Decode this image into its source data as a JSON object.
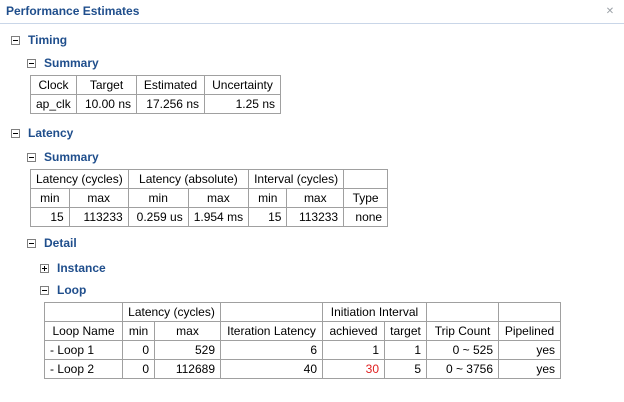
{
  "header": {
    "title": "Performance Estimates"
  },
  "sections": {
    "timing": "Timing",
    "timing_summary": "Summary",
    "latency": "Latency",
    "latency_summary": "Summary",
    "detail": "Detail",
    "instance": "Instance",
    "loop": "Loop"
  },
  "timing_table": {
    "headers": [
      "Clock",
      "Target",
      "Estimated",
      "Uncertainty"
    ],
    "rows": [
      [
        "ap_clk",
        "10.00 ns",
        "17.256 ns",
        "1.25 ns"
      ]
    ]
  },
  "latency_table": {
    "group_headers": [
      "Latency (cycles)",
      "Latency (absolute)",
      "Interval (cycles)"
    ],
    "sub_headers": [
      "min",
      "max",
      "min",
      "max",
      "min",
      "max",
      "Type"
    ],
    "rows": [
      [
        "15",
        "113233",
        "0.259 us",
        "1.954 ms",
        "15",
        "113233",
        "none"
      ]
    ]
  },
  "loop_table": {
    "group_headers": [
      "Latency (cycles)",
      "Initiation Interval"
    ],
    "sub_headers": [
      "Loop Name",
      "min",
      "max",
      "Iteration Latency",
      "achieved",
      "target",
      "Trip Count",
      "Pipelined"
    ],
    "rows": [
      [
        "- Loop 1",
        "0",
        "529",
        "6",
        "1",
        "1",
        "0 ~ 525",
        "yes"
      ],
      [
        "- Loop 2",
        "0",
        "112689",
        "40",
        "30",
        "5",
        "0 ~ 3756",
        "yes"
      ]
    ]
  },
  "colors": {
    "section_label": "#1f4e8c",
    "violation": "#e02020",
    "border": "#a0a0a0"
  }
}
